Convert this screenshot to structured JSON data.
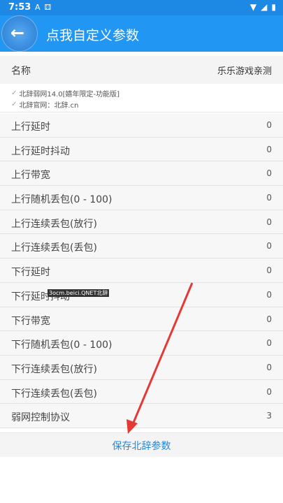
{
  "status_bar": {
    "time": "7:53",
    "notif_icons": [
      "A",
      "⚃"
    ]
  },
  "app_bar": {
    "title": "点我自定义参数"
  },
  "name_row": {
    "label": "名称",
    "value": "乐乐游戏亲测"
  },
  "info": {
    "line1": "北辞弱网14.0[嬉年限定-功能版]",
    "line2": "北辞官网：北辞.cn"
  },
  "params": [
    {
      "label": "上行延时",
      "value": "0"
    },
    {
      "label": "上行延时抖动",
      "value": "0"
    },
    {
      "label": "上行带宽",
      "value": "0"
    },
    {
      "label": "上行随机丢包(0 - 100)",
      "value": "0"
    },
    {
      "label": "上行连续丢包(放行)",
      "value": "0"
    },
    {
      "label": "上行连续丢包(丢包)",
      "value": "0"
    },
    {
      "label": "下行延时",
      "value": "0"
    },
    {
      "label": "下行延时抖动",
      "value": "0"
    },
    {
      "label": "下行带宽",
      "value": "0"
    },
    {
      "label": "下行随机丢包(0 - 100)",
      "value": "0"
    },
    {
      "label": "下行连续丢包(放行)",
      "value": "0"
    },
    {
      "label": "下行连续丢包(丢包)",
      "value": "0"
    },
    {
      "label": "弱网控制协议",
      "value": "3"
    }
  ],
  "watermark": "3ocm.beici.QNET北辞",
  "save_button": "保存北辞参数",
  "colors": {
    "accent": "#2196f3",
    "statusbar": "#1e88e5",
    "arrow": "#e53935"
  }
}
